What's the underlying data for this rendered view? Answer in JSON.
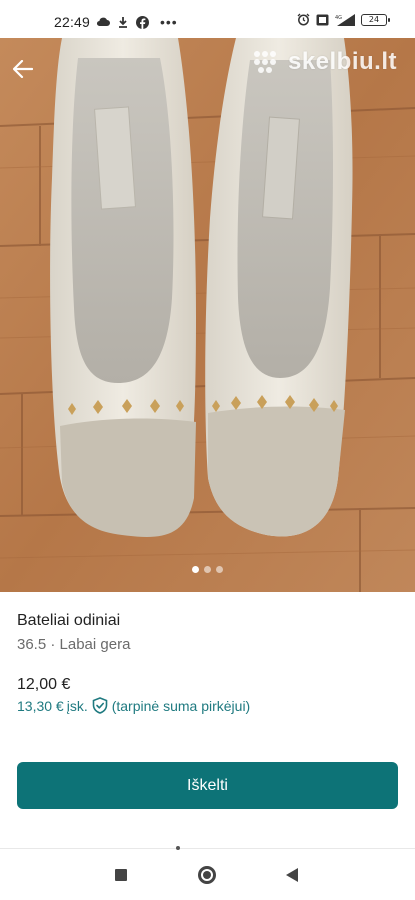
{
  "status_bar": {
    "time": "22:49",
    "left_icons": [
      "cloud-icon",
      "download-icon",
      "facebook-icon"
    ],
    "more": "•••",
    "right_icons": [
      "alarm-icon",
      "volte-icon",
      "signal-icon"
    ],
    "battery": "24"
  },
  "gallery": {
    "watermark": "skelbiu.lt",
    "page_count": 3,
    "active_page": 1
  },
  "listing": {
    "title": "Bateliai odiniai",
    "subtitle": "36.5 · Labai gera",
    "price": "12,00 €",
    "price_protected": "13,30 €",
    "price_protected_suffix": "įsk.",
    "protection_note": "(tarpinė suma pirkėjui)"
  },
  "actions": {
    "primary_button": "Iškelti"
  },
  "colors": {
    "accent": "#0d7377",
    "accent_text": "#1f7a80"
  }
}
